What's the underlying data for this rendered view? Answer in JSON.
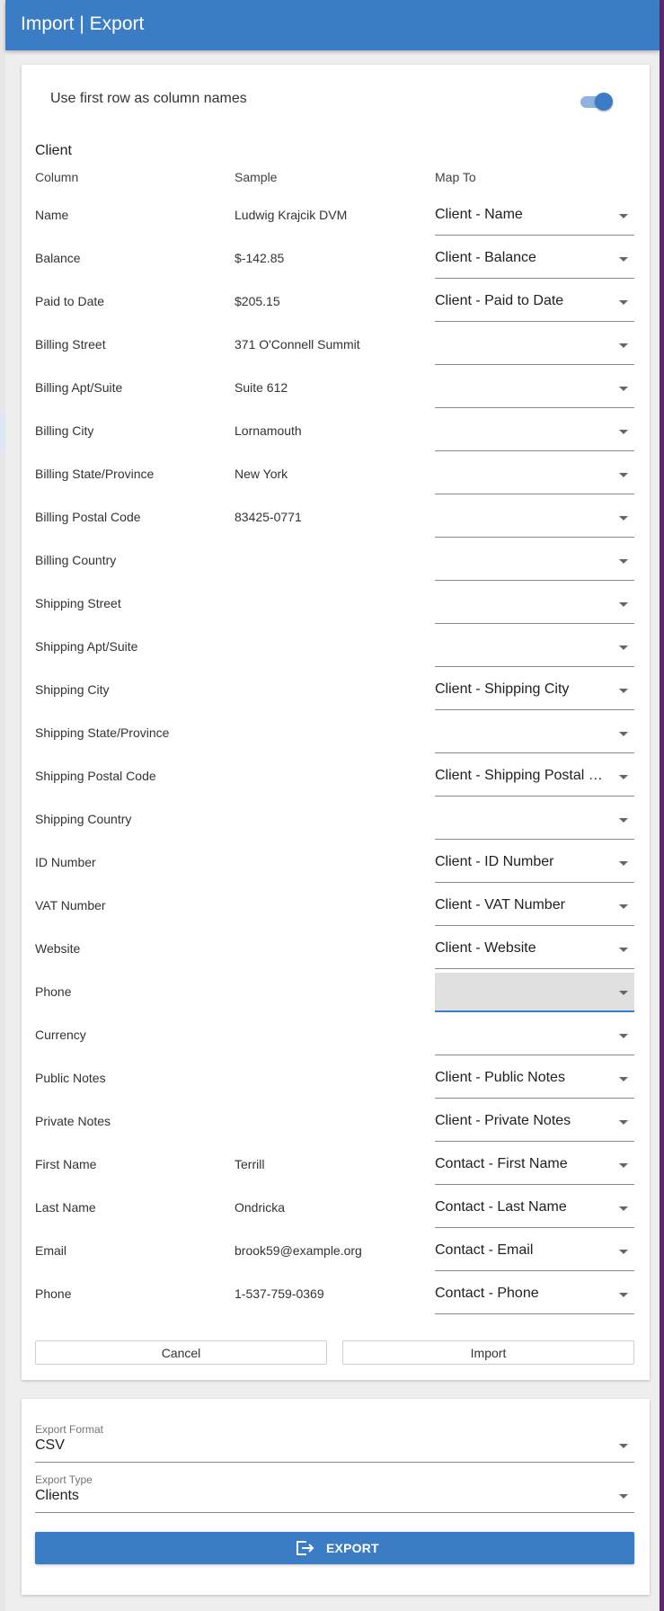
{
  "app": {
    "title": "Import | Export"
  },
  "import": {
    "toggle_label": "Use first row as column names",
    "toggle_on": true,
    "section_title": "Client",
    "headers": {
      "column": "Column",
      "sample": "Sample",
      "map_to": "Map To"
    },
    "rows": [
      {
        "column": "Name",
        "sample": "Ludwig Krajcik DVM",
        "map_to": "Client - Name"
      },
      {
        "column": "Balance",
        "sample": "$-142.85",
        "map_to": "Client - Balance"
      },
      {
        "column": "Paid to Date",
        "sample": "$205.15",
        "map_to": "Client - Paid to Date"
      },
      {
        "column": "Billing Street",
        "sample": "371 O'Connell Summit",
        "map_to": ""
      },
      {
        "column": "Billing Apt/Suite",
        "sample": "Suite 612",
        "map_to": ""
      },
      {
        "column": "Billing City",
        "sample": "Lornamouth",
        "map_to": ""
      },
      {
        "column": "Billing State/Province",
        "sample": "New York",
        "map_to": ""
      },
      {
        "column": "Billing Postal Code",
        "sample": "83425-0771",
        "map_to": ""
      },
      {
        "column": "Billing Country",
        "sample": "",
        "map_to": ""
      },
      {
        "column": "Shipping Street",
        "sample": "",
        "map_to": ""
      },
      {
        "column": "Shipping Apt/Suite",
        "sample": "",
        "map_to": ""
      },
      {
        "column": "Shipping City",
        "sample": "",
        "map_to": "Client - Shipping City"
      },
      {
        "column": "Shipping State/Province",
        "sample": "",
        "map_to": ""
      },
      {
        "column": "Shipping Postal Code",
        "sample": "",
        "map_to": "Client - Shipping Postal Code"
      },
      {
        "column": "Shipping Country",
        "sample": "",
        "map_to": ""
      },
      {
        "column": "ID Number",
        "sample": "",
        "map_to": "Client - ID Number"
      },
      {
        "column": "VAT Number",
        "sample": "",
        "map_to": "Client - VAT Number"
      },
      {
        "column": "Website",
        "sample": "",
        "map_to": "Client - Website"
      },
      {
        "column": "Phone",
        "sample": "",
        "map_to": "",
        "focused": true
      },
      {
        "column": "Currency",
        "sample": "",
        "map_to": ""
      },
      {
        "column": "Public Notes",
        "sample": "",
        "map_to": "Client - Public Notes"
      },
      {
        "column": "Private Notes",
        "sample": "",
        "map_to": "Client - Private Notes"
      },
      {
        "column": "First Name",
        "sample": "Terrill",
        "map_to": "Contact - First Name"
      },
      {
        "column": "Last Name",
        "sample": "Ondricka",
        "map_to": "Contact - Last Name"
      },
      {
        "column": "Email",
        "sample": "brook59@example.org",
        "map_to": "Contact - Email"
      },
      {
        "column": "Phone",
        "sample": "1-537-759-0369",
        "map_to": "Contact - Phone"
      }
    ],
    "cancel_label": "Cancel",
    "import_label": "Import"
  },
  "export": {
    "format_label": "Export Format",
    "format_value": "CSV",
    "type_label": "Export Type",
    "type_value": "Clients",
    "button_label": "EXPORT",
    "button_icon": "export-icon"
  },
  "colors": {
    "primary": "#3b7dc4",
    "toggle_track": "#8fb3e0",
    "background": "#eeeeee"
  }
}
